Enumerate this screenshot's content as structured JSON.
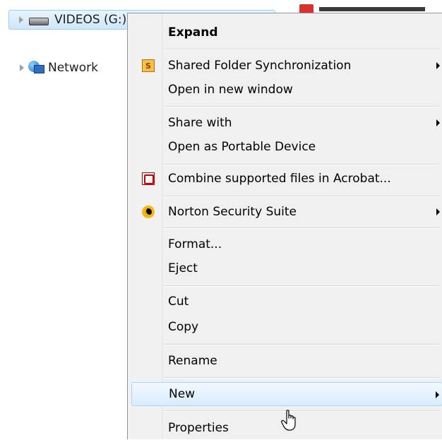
{
  "nav": {
    "drive_label": "VIDEOS (G:)",
    "network_label": "Network"
  },
  "menu": {
    "expand": "Expand",
    "shared_folder_sync": "Shared Folder Synchronization",
    "open_new_window": "Open in new window",
    "share_with": "Share with",
    "open_portable": "Open as Portable Device",
    "combine_acrobat": "Combine supported files in Acrobat...",
    "norton": "Norton Security Suite",
    "format": "Format...",
    "eject": "Eject",
    "cut": "Cut",
    "copy": "Copy",
    "rename": "Rename",
    "new": "New",
    "properties": "Properties",
    "sync_icon_glyph": "S"
  },
  "icons": [
    "drive-icon",
    "network-icon",
    "shared-folder-sync-icon",
    "acrobat-icon",
    "norton-icon",
    "hand-cursor-icon"
  ],
  "colors": {
    "hover_border": "#a9d4fa",
    "selection_fill": "#cfe6fb",
    "menu_bg": "#f0f0f0"
  }
}
